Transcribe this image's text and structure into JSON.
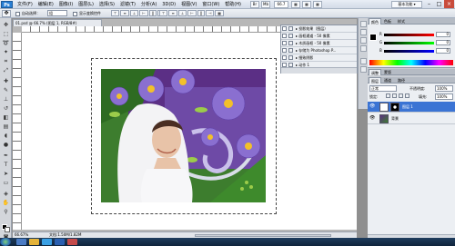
{
  "app": {
    "logo": "Ps"
  },
  "menu": {
    "items": [
      "文件(F)",
      "编辑(E)",
      "图像(I)",
      "图层(L)",
      "选择(S)",
      "滤镜(T)",
      "分析(A)",
      "3D(D)",
      "视图(V)",
      "窗口(W)",
      "帮助(H)"
    ]
  },
  "appbar": {
    "zoom": "66.7",
    "workspace": "基本功能 ▾",
    "buttons": [
      "Br",
      "Mb",
      "▦",
      "▦",
      "▦"
    ]
  },
  "options": {
    "auto_select_label": "自动选择：",
    "auto_select_value": "组",
    "show_transform_label": "显示变换控件"
  },
  "document": {
    "tab_title": "01.psd @ 66.7% (图层 1, RGB/8#)",
    "status_zoom": "66.67%",
    "status_doc": "文档:1.50M/1.82M"
  },
  "actions_panel": {
    "rows": [
      {
        "label": "▸ 投影效果（图层）"
      },
      {
        "label": "▸ 画框通道 - 50 像素"
      },
      {
        "label": "▸ 木质画框 - 50 像素"
      },
      {
        "label": "▸ 存储为 Photoshop P..."
      },
      {
        "label": "▸ 细致阴影"
      },
      {
        "label": "▸ 动作 1"
      }
    ]
  },
  "color_panel": {
    "tabs": [
      "颜色",
      "色板",
      "样式"
    ],
    "channels": [
      {
        "label": "R",
        "value": "0",
        "color": "#ff3030"
      },
      {
        "label": "G",
        "value": "0",
        "color": "#30c030"
      },
      {
        "label": "B",
        "value": "0",
        "color": "#3060ff"
      }
    ]
  },
  "adjust_panel": {
    "tabs": [
      "调整",
      "蒙版"
    ]
  },
  "layers_panel": {
    "tabs": [
      "图层",
      "通道",
      "路径"
    ],
    "blend_mode": "正常",
    "opacity_label": "不透明度:",
    "opacity_value": "100%",
    "lock_label": "锁定:",
    "fill_label": "填充:",
    "fill_value": "100%",
    "layers": [
      {
        "name": "图层 1",
        "selected": true
      },
      {
        "name": "背景",
        "selected": false
      }
    ]
  },
  "taskbar": {
    "time": "",
    "icons": [
      "#4a7bc4",
      "#e4b33a",
      "#3aa0e4",
      "#2a5fb0",
      "#c44a4a"
    ]
  },
  "colors": {
    "accent": "#3b74d4",
    "photo_purple": "#6b3a9c"
  }
}
